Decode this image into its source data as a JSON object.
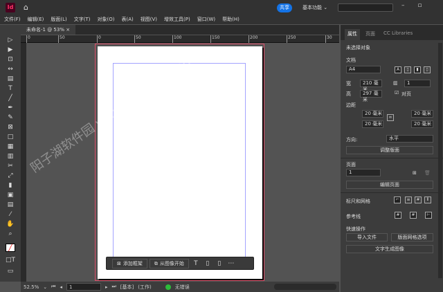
{
  "app": {
    "logo": "Id",
    "share": "共享",
    "workspace": "基本功能 ⌄",
    "window_controls": "– ▫"
  },
  "menu": [
    "文件(F)",
    "编辑(E)",
    "版面(L)",
    "文字(T)",
    "对象(O)",
    "表(A)",
    "视图(V)",
    "增效工具(P)",
    "窗口(W)",
    "帮助(H)"
  ],
  "document_tab": "未命名-1 @ 53% ×",
  "ruler_ticks": [
    "0",
    "50",
    "0",
    "50",
    "100",
    "150",
    "200",
    "250",
    "30"
  ],
  "context_bar": {
    "add_frame": "添加框架",
    "start_from_image": "从图像开始"
  },
  "status": {
    "zoom": "52.5%",
    "page": "1",
    "master": "[基本]",
    "profile": "(工作)",
    "preflight": "无错误"
  },
  "panel": {
    "tabs": [
      "属性",
      "页面",
      "CC Libraries"
    ],
    "no_selection": "未选择对象",
    "document": "文档",
    "preset": "A4",
    "width_label": "宽",
    "width": "210 毫米",
    "height_label": "高",
    "height": "297 毫米",
    "pages_count": "1",
    "facing_pages": "对页",
    "margins_label": "边距",
    "margin_top": "20 毫米",
    "margin_bottom": "20 毫米",
    "margin_left": "20 毫米",
    "margin_right": "20 毫米",
    "orientation_label": "方向:",
    "orientation": "水平",
    "adjust_layout": "调整版面",
    "pages_label": "页面",
    "page": "1",
    "edit_page": "编辑页面",
    "rulers_grids": "标尺和网格",
    "guides": "参考线",
    "quick_actions": "快速操作",
    "import_file": "导入文件",
    "layout_grid_options": "版面网格选项",
    "text_to_image": "文字生成图像"
  },
  "watermark": "阳子湖软件园 www.yangzhu.com"
}
